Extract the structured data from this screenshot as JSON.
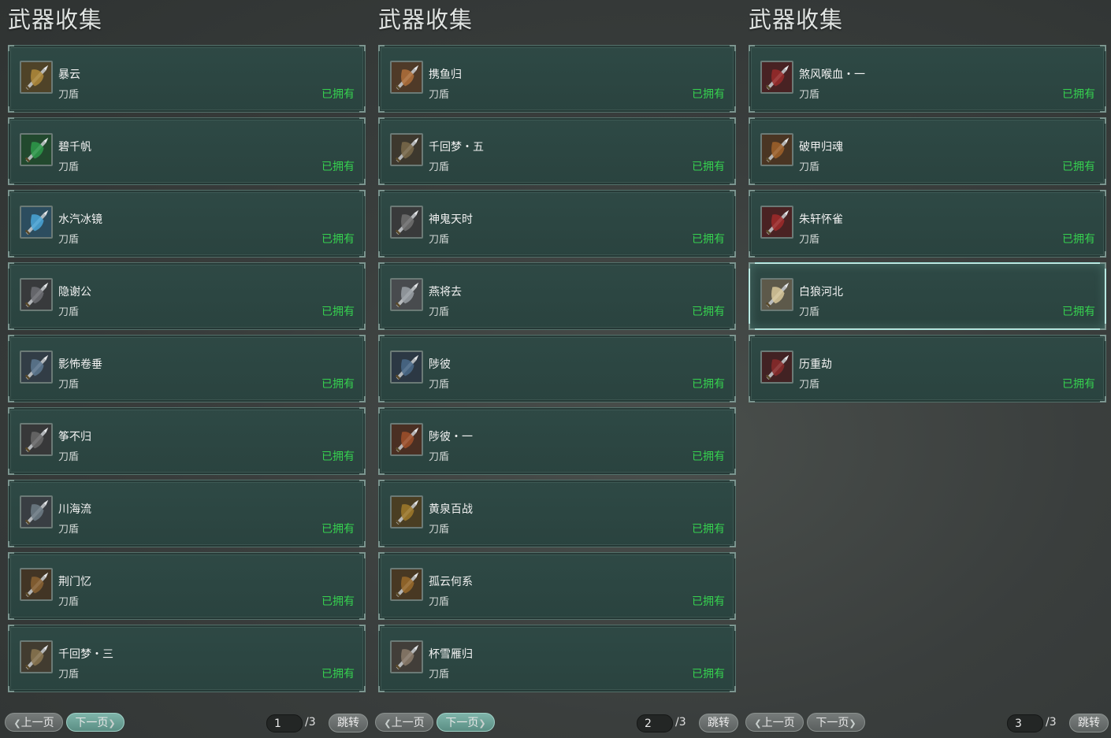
{
  "panels": [
    {
      "title": "武器收集",
      "items": [
        {
          "name": "暴云",
          "type": "刀盾",
          "status": "已拥有",
          "icon": "weapon-icon",
          "color": "#b08a3a"
        },
        {
          "name": "碧千帆",
          "type": "刀盾",
          "status": "已拥有",
          "icon": "weapon-icon",
          "color": "#2e9a4a"
        },
        {
          "name": "水汽冰镜",
          "type": "刀盾",
          "status": "已拥有",
          "icon": "weapon-icon",
          "color": "#4aa6d8"
        },
        {
          "name": "隐谢公",
          "type": "刀盾",
          "status": "已拥有",
          "icon": "weapon-icon",
          "color": "#6d6f73"
        },
        {
          "name": "影怖卷垂",
          "type": "刀盾",
          "status": "已拥有",
          "icon": "weapon-icon",
          "color": "#5d7890"
        },
        {
          "name": "筝不归",
          "type": "刀盾",
          "status": "已拥有",
          "icon": "weapon-icon",
          "color": "#6a6a6a"
        },
        {
          "name": "川海流",
          "type": "刀盾",
          "status": "已拥有",
          "icon": "weapon-icon",
          "color": "#6f7c86"
        },
        {
          "name": "荆门忆",
          "type": "刀盾",
          "status": "已拥有",
          "icon": "weapon-icon",
          "color": "#8a6232"
        },
        {
          "name": "千回梦・三",
          "type": "刀盾",
          "status": "已拥有",
          "icon": "weapon-icon",
          "color": "#8a7650"
        }
      ],
      "pager": {
        "prev": "上一页",
        "next": "下一页",
        "active": "next",
        "page": "1",
        "total": "/3",
        "jump": "跳转"
      }
    },
    {
      "title": "武器收集",
      "items": [
        {
          "name": "携鱼归",
          "type": "刀盾",
          "status": "已拥有",
          "icon": "weapon-icon",
          "color": "#b0703a"
        },
        {
          "name": "千回梦・五",
          "type": "刀盾",
          "status": "已拥有",
          "icon": "weapon-icon",
          "color": "#7a6a4a"
        },
        {
          "name": "神鬼天时",
          "type": "刀盾",
          "status": "已拥有",
          "icon": "weapon-icon",
          "color": "#707070"
        },
        {
          "name": "燕将去",
          "type": "刀盾",
          "status": "已拥有",
          "icon": "weapon-icon",
          "color": "#9aa0a6"
        },
        {
          "name": "陟彼",
          "type": "刀盾",
          "status": "已拥有",
          "icon": "weapon-icon",
          "color": "#4a6a8a"
        },
        {
          "name": "陟彼・一",
          "type": "刀盾",
          "status": "已拥有",
          "icon": "weapon-icon",
          "color": "#a0502a"
        },
        {
          "name": "黄泉百战",
          "type": "刀盾",
          "status": "已拥有",
          "icon": "weapon-icon",
          "color": "#a07a2a"
        },
        {
          "name": "孤云何系",
          "type": "刀盾",
          "status": "已拥有",
          "icon": "weapon-icon",
          "color": "#9a6a2a"
        },
        {
          "name": "杯雪雁归",
          "type": "刀盾",
          "status": "已拥有",
          "icon": "weapon-icon",
          "color": "#8a7a6a"
        }
      ],
      "pager": {
        "prev": "上一页",
        "next": "下一页",
        "active": "next",
        "page": "2",
        "total": "/3",
        "jump": "跳转"
      }
    },
    {
      "title": "武器收集",
      "items": [
        {
          "name": "煞风喉血・一",
          "type": "刀盾",
          "status": "已拥有",
          "icon": "weapon-icon",
          "color": "#9a2a2a"
        },
        {
          "name": "破甲归魂",
          "type": "刀盾",
          "status": "已拥有",
          "icon": "weapon-icon",
          "color": "#a0622a"
        },
        {
          "name": "朱轩怀雀",
          "type": "刀盾",
          "status": "已拥有",
          "icon": "weapon-icon",
          "color": "#a02a2a"
        },
        {
          "name": "白狼河北",
          "type": "刀盾",
          "status": "已拥有",
          "icon": "weapon-icon",
          "color": "#d8c89a",
          "selected": true
        },
        {
          "name": "历重劫",
          "type": "刀盾",
          "status": "已拥有",
          "icon": "weapon-icon",
          "color": "#8a2a2a"
        }
      ],
      "pager": {
        "prev": "上一页",
        "next": "下一页",
        "active": "none",
        "page": "3",
        "total": "/3",
        "jump": "跳转"
      }
    }
  ]
}
